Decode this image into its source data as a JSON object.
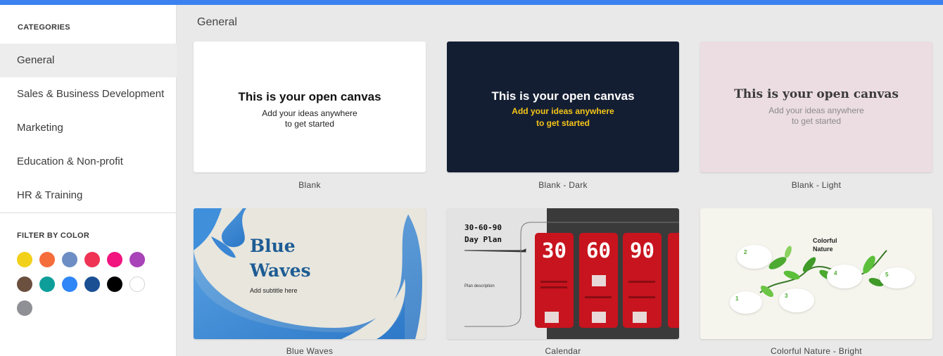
{
  "sidebar": {
    "categories_heading": "CATEGORIES",
    "categories": [
      {
        "label": "General",
        "active": true
      },
      {
        "label": "Sales & Business Development",
        "active": false
      },
      {
        "label": "Marketing",
        "active": false
      },
      {
        "label": "Education & Non-profit",
        "active": false
      },
      {
        "label": "HR & Training",
        "active": false
      }
    ],
    "filter_heading": "FILTER BY COLOR",
    "colors": [
      "#f2d11b",
      "#f56d3b",
      "#6c8ec4",
      "#ee3355",
      "#f2147f",
      "#a843b8",
      "#6b4f3f",
      "#0e9e9a",
      "#2f86f6",
      "#1b4f93",
      "#000000",
      "#ffffff",
      "#8f9095"
    ]
  },
  "main": {
    "title": "General",
    "templates": [
      {
        "caption": "Blank",
        "heading": "This is your open canvas",
        "line1": "Add your ideas anywhere",
        "line2": "to get started",
        "background": "#ffffff",
        "heading_color": "#111111",
        "text_color": "#222222"
      },
      {
        "caption": "Blank - Dark",
        "heading": "This is your open canvas",
        "line1": "Add your ideas anywhere",
        "line2": "to get started",
        "background": "#141e33",
        "heading_color": "#ffffff",
        "text_color": "#f5c518"
      },
      {
        "caption": "Blank - Light",
        "heading": "This is your open canvas",
        "line1": "Add your ideas anywhere",
        "line2": "to get started",
        "background": "#ecdde2",
        "heading_color": "#3a3a3a",
        "text_color": "#8a8a8a"
      },
      {
        "caption": "Blue Waves",
        "heading_line1": "Blue",
        "heading_line2": "Waves",
        "subtitle": "Add subtitle here",
        "background": "#e8e6dd",
        "accent": "#1e5c94"
      },
      {
        "caption": "Calendar",
        "title_line1": "30-60-90",
        "title_line2": "Day Plan",
        "description": "Plan description",
        "numbers": [
          "30",
          "60",
          "90"
        ],
        "accent": "#c8141e"
      },
      {
        "caption": "Colorful Nature - Bright",
        "title_line1": "Colorful",
        "title_line2": "Nature",
        "steps": [
          "1",
          "2",
          "3",
          "4",
          "5"
        ],
        "background": "#f5f5ee"
      }
    ]
  }
}
